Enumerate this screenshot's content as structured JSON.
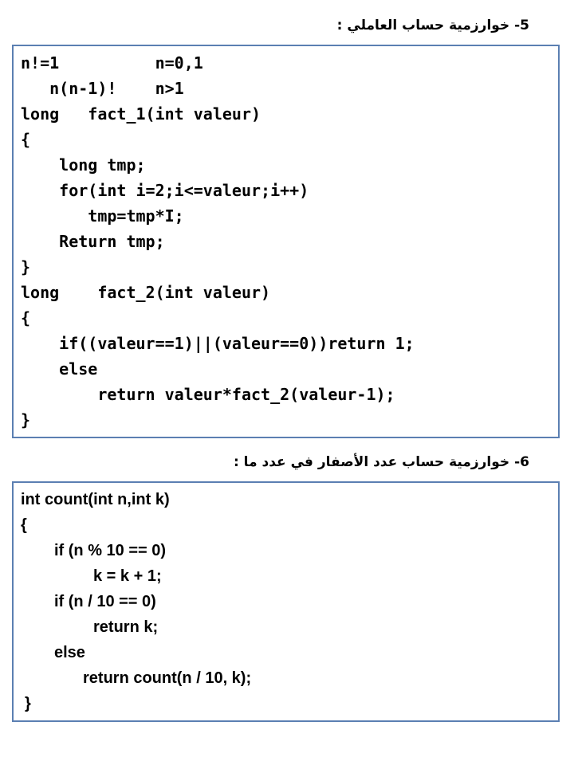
{
  "section5": {
    "heading": "5- خوارزمية حساب العاملي :",
    "code": [
      "n!=1          n=0,1",
      "   n(n-1)!    n>1",
      "long   fact_1(int valeur)",
      "{",
      "    long tmp;",
      "    for(int i=2;i<=valeur;i++)",
      "       tmp=tmp*I;",
      "    Return tmp;",
      "}",
      "long    fact_2(int valeur)",
      "{",
      "    if((valeur==1)||(valeur==0))return 1;",
      "    else",
      "        return valeur*fact_2(valeur-1);",
      "}"
    ]
  },
  "section6": {
    "heading": "6- خوارزمية حساب عدد الأصفار في عدد ما :",
    "code": [
      "int count(int n,int k)",
      "{",
      "if (n % 10 == 0)",
      "k = k + 1;",
      "if (n / 10 == 0)",
      "return k;",
      "else",
      "return count(n / 10, k);",
      "}"
    ]
  }
}
